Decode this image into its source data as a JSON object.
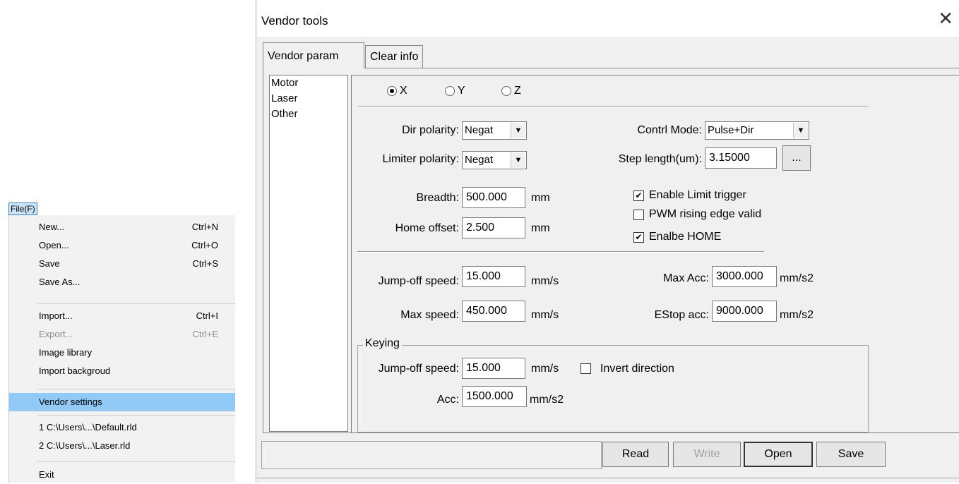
{
  "menu": {
    "title": "File(F)",
    "items": [
      {
        "label": "New...",
        "shortcut": "Ctrl+N"
      },
      {
        "label": "Open...",
        "shortcut": "Ctrl+O"
      },
      {
        "label": "Save",
        "shortcut": "Ctrl+S"
      },
      {
        "label": "Save As...",
        "shortcut": ""
      },
      {
        "label": "Import...",
        "shortcut": "Ctrl+I"
      },
      {
        "label": "Export...",
        "shortcut": "Ctrl+E"
      },
      {
        "label": "Image library",
        "shortcut": ""
      },
      {
        "label": "Import backgroud",
        "shortcut": ""
      },
      {
        "label": "Vendor settings",
        "shortcut": ""
      },
      {
        "label": "1 C:\\Users\\...\\Default.rld",
        "shortcut": ""
      },
      {
        "label": "2 C:\\Users\\...\\Laser.rld",
        "shortcut": ""
      },
      {
        "label": "Exit",
        "shortcut": ""
      }
    ]
  },
  "dialog": {
    "title": "Vendor tools",
    "close_glyph": "✕",
    "tabs": [
      "Vendor param",
      "Clear info"
    ],
    "left_list": [
      "Motor",
      "Laser",
      "Other"
    ],
    "axes": {
      "x": "X",
      "y": "Y",
      "z": "Z",
      "selected": "X"
    },
    "dir_polarity": {
      "label": "Dir polarity:",
      "value": "Negat"
    },
    "limiter_polarity": {
      "label": "Limiter polarity:",
      "value": "Negat"
    },
    "contrl_mode": {
      "label": "Contrl Mode:",
      "value": "Pulse+Dir"
    },
    "step_length": {
      "label": "Step length(um):",
      "value": "3.15000",
      "button": "..."
    },
    "breadth": {
      "label": "Breadth:",
      "value": "500.000",
      "unit": "mm"
    },
    "home_offset": {
      "label": "Home offset:",
      "value": "2.500",
      "unit": "mm"
    },
    "checks": {
      "enable_limit": {
        "label": "Enable Limit trigger",
        "checked": true
      },
      "pwm_rising": {
        "label": "PWM rising edge valid",
        "checked": false
      },
      "enable_home": {
        "label": "Enalbe HOME",
        "checked": true
      }
    },
    "jump_off_speed": {
      "label": "Jump-off speed:",
      "value": "15.000",
      "unit": "mm/s"
    },
    "max_speed": {
      "label": "Max speed:",
      "value": "450.000",
      "unit": "mm/s"
    },
    "max_acc": {
      "label": "Max Acc:",
      "value": "3000.000",
      "unit": "mm/s2"
    },
    "estop_acc": {
      "label": "EStop acc:",
      "value": "9000.000",
      "unit": "mm/s2"
    },
    "keying": {
      "title": "Keying",
      "jump_off_speed": {
        "label": "Jump-off speed:",
        "value": "15.000",
        "unit": "mm/s"
      },
      "invert_direction": {
        "label": "Invert direction",
        "checked": false
      },
      "acc": {
        "label": "Acc:",
        "value": "1500.000",
        "unit": "mm/s2"
      }
    },
    "buttons": {
      "read": "Read",
      "write": "Write",
      "open": "Open",
      "save": "Save"
    },
    "check_glyph": "✔",
    "arrow_glyph": "▼"
  }
}
